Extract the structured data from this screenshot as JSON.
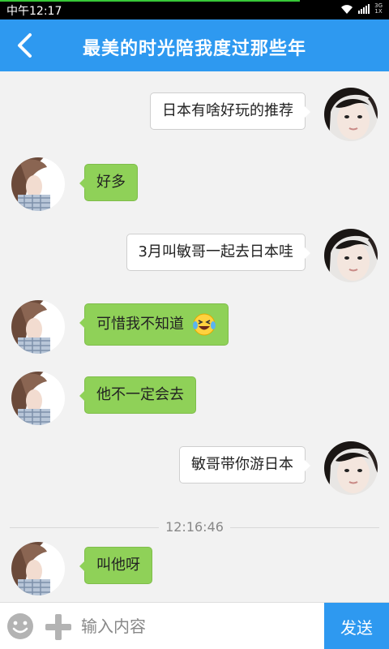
{
  "status_bar": {
    "time": "中午12:17",
    "network": "3G",
    "network_sub": "1X",
    "progress_fraction": 0.77
  },
  "header": {
    "title": "最美的时光陪我度过那些年"
  },
  "messages": [
    {
      "text": "日本有啥好玩的推荐"
    },
    {
      "text": "好多"
    },
    {
      "text": "3月叫敏哥一起去日本哇"
    },
    {
      "text": "可惜我不知道"
    },
    {
      "text": "他不一定会去"
    },
    {
      "text": "敏哥带你游日本"
    },
    {
      "text": "叫他呀"
    }
  ],
  "divider_time": "12:16:46",
  "input": {
    "placeholder": "输入内容",
    "value": ""
  },
  "send_label": "发送",
  "colors": {
    "brand_blue": "#2e99f0",
    "incoming_green": "#8fd158",
    "outgoing_white": "#ffffff"
  },
  "icons": [
    "back-icon",
    "wifi-icon",
    "signal-icon",
    "laughing-tears-emoji",
    "smile-icon",
    "plus-icon"
  ]
}
